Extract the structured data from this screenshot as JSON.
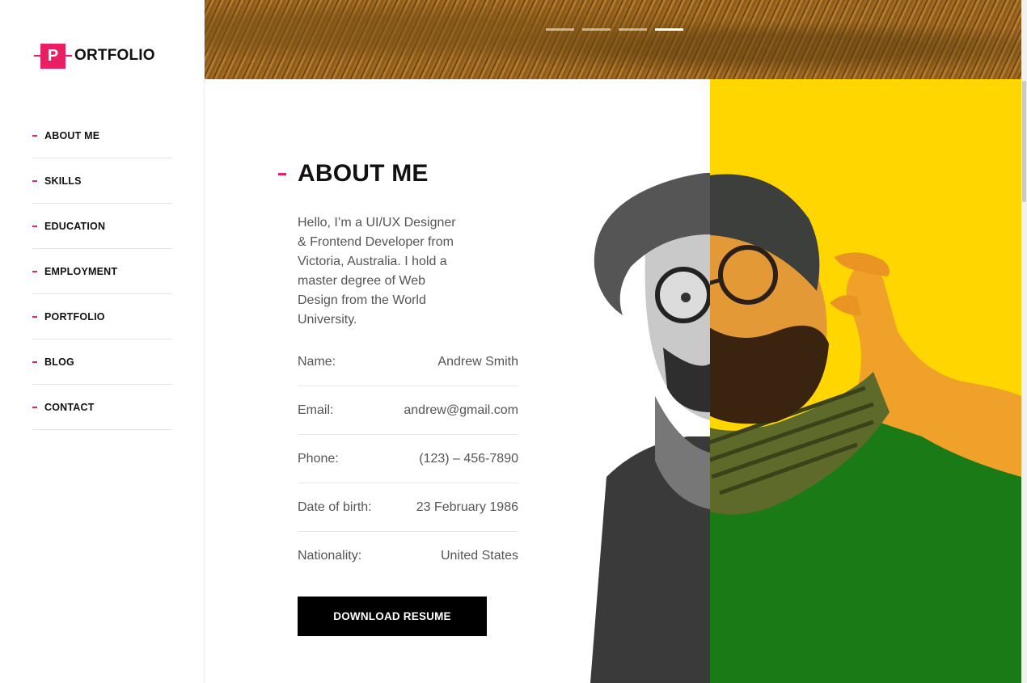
{
  "logo": {
    "letter": "P",
    "word": "ORTFOLIO"
  },
  "nav": {
    "items": [
      {
        "label": "ABOUT ME"
      },
      {
        "label": "SKILLS"
      },
      {
        "label": "EDUCATION"
      },
      {
        "label": "EMPLOYMENT"
      },
      {
        "label": "PORTFOLIO"
      },
      {
        "label": "BLOG"
      },
      {
        "label": "CONTACT"
      }
    ]
  },
  "slider": {
    "count": 4,
    "active_index": 3
  },
  "about": {
    "title": "ABOUT ME",
    "intro": "Hello, I’m a UI/UX Designer & Frontend Developer from Victoria, Australia. I hold a master degree of Web Design from the World University.",
    "info": [
      {
        "label": "Name:",
        "value": "Andrew Smith"
      },
      {
        "label": "Email:",
        "value": "andrew@gmail.com"
      },
      {
        "label": "Phone:",
        "value": "(123) – 456-7890"
      },
      {
        "label": "Date of birth:",
        "value": "23 February 1986"
      },
      {
        "label": "Nationality:",
        "value": "United States"
      }
    ],
    "download_label": "DOWNLOAD RESUME"
  },
  "colors": {
    "accent": "#e91e63",
    "panel": "#ffd600",
    "button": "#000000"
  }
}
